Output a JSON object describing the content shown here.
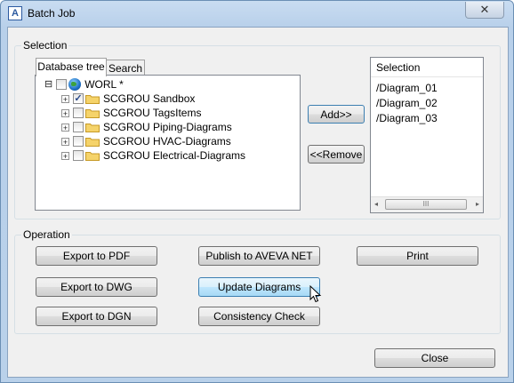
{
  "window": {
    "title": "Batch Job",
    "app_icon": "A",
    "close_label": "✕"
  },
  "selection_group": {
    "label": "Selection",
    "tabs": [
      {
        "label": "Database tree"
      },
      {
        "label": "Search"
      }
    ],
    "tree": {
      "root": {
        "expander": "⊟",
        "label": "WORL *",
        "icon": "globe-icon"
      },
      "items": [
        {
          "label": "SCGROU Sandbox",
          "checked": true
        },
        {
          "label": "SCGROU TagsItems",
          "checked": false
        },
        {
          "label": "SCGROU Piping-Diagrams",
          "checked": false
        },
        {
          "label": "SCGROU HVAC-Diagrams",
          "checked": false
        },
        {
          "label": "SCGROU Electrical-Diagrams",
          "checked": false
        }
      ]
    },
    "add_label": "Add>>",
    "remove_label": "<<Remove",
    "list": {
      "header": "Selection",
      "items": [
        "/Diagram_01",
        "/Diagram_02",
        "/Diagram_03"
      ],
      "scroll_left": "◂",
      "scroll_right": "▸",
      "thumb_grip": "III"
    }
  },
  "operation_group": {
    "label": "Operation",
    "buttons": {
      "export_pdf": "Export to PDF",
      "export_dwg": "Export to DWG",
      "export_dgn": "Export to DGN",
      "publish_aveva": "Publish to AVEVA NET",
      "update_diagrams": "Update Diagrams",
      "consistency_check": "Consistency Check",
      "print": "Print"
    }
  },
  "footer": {
    "close_label": "Close"
  },
  "colors": {
    "title_bar": "#b9d1ea",
    "hover_button": "#bee6fd",
    "folder": "#f5d36a",
    "checkmark": "#2a4a8a"
  }
}
